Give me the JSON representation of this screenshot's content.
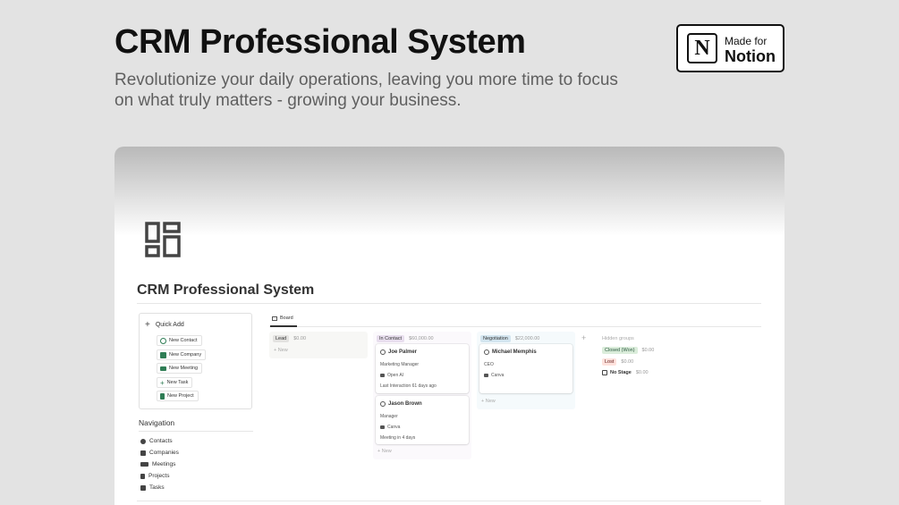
{
  "hero": {
    "title": "CRM Professional System",
    "subtitle": "Revolutionize your daily operations, leaving you more time to focus on what truly matters - growing your business."
  },
  "badge": {
    "logo_letter": "N",
    "line1": "Made for",
    "line2": "Notion"
  },
  "page": {
    "title": "CRM Professional System",
    "icon": "dashboard-icon"
  },
  "quick_add": {
    "header": "Quick Add",
    "buttons": [
      {
        "label": "New Contact",
        "icon": "contact-icon"
      },
      {
        "label": "New Company",
        "icon": "company-icon"
      },
      {
        "label": "New Meeting",
        "icon": "meeting-icon"
      },
      {
        "label": "New Task",
        "icon": "plus-icon"
      },
      {
        "label": "New Project",
        "icon": "document-icon"
      }
    ]
  },
  "navigation": {
    "title": "Navigation",
    "items": [
      {
        "label": "Contacts",
        "icon": "contacts-icon"
      },
      {
        "label": "Companies",
        "icon": "companies-icon"
      },
      {
        "label": "Meetings",
        "icon": "meetings-icon"
      },
      {
        "label": "Projects",
        "icon": "projects-icon"
      },
      {
        "label": "Tasks",
        "icon": "tasks-icon"
      }
    ]
  },
  "board": {
    "tab_label": "Board",
    "new_label": "+ New",
    "columns": [
      {
        "name": "Lead",
        "sum": "$0.00",
        "color": "#e3e2e0",
        "bg": "#f7f7f5",
        "cards": []
      },
      {
        "name": "In Contact",
        "sum": "$60,000.00",
        "color": "#e8deee",
        "bg": "#fbf9fc",
        "cards": [
          {
            "name": "Joe Palmer",
            "role": "Marketing Manager",
            "company": "Open AI",
            "note": "Last Interaction 61 days ago"
          },
          {
            "name": "Jason Brown",
            "role": "Manager",
            "company": "Canva",
            "note": "Meeting in 4 days"
          }
        ]
      },
      {
        "name": "Negotiation",
        "sum": "$22,000.00",
        "color": "#d3e5ef",
        "bg": "#f5fafc",
        "cards": [
          {
            "name": "Michael Memphis",
            "role": "CEO",
            "company": "Canva",
            "note": ""
          }
        ]
      }
    ],
    "add_symbol": "+",
    "hidden_groups": {
      "title": "Hidden groups",
      "items": [
        {
          "name": "Closed (Won)",
          "sum": "$0.00",
          "color": "#dbeddb",
          "text_color": "#2b593f"
        },
        {
          "name": "Lost",
          "sum": "$0.00",
          "color": "#ffe2dd",
          "text_color": "#5d1715"
        },
        {
          "name": "No Stage",
          "sum": "$0.00",
          "color": "",
          "text_color": "#333"
        }
      ]
    }
  }
}
